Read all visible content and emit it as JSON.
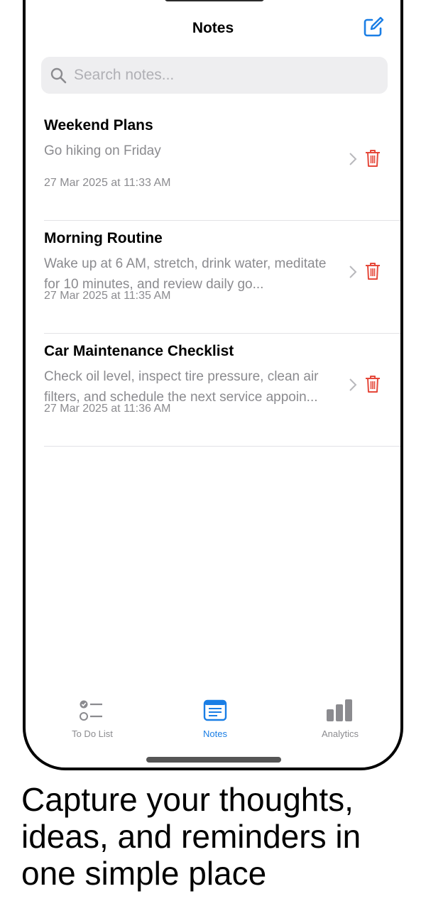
{
  "header": {
    "title": "Notes",
    "compose_icon": "compose-icon"
  },
  "search": {
    "placeholder": "Search notes..."
  },
  "notes": [
    {
      "title": "Weekend Plans",
      "body": "Go hiking on Friday",
      "date": "27 Mar 2025 at 11:33 AM"
    },
    {
      "title": "Morning Routine",
      "body": "Wake up at 6 AM, stretch, drink water, meditate for 10 minutes, and review daily go...",
      "date": "27 Mar 2025 at 11:35 AM"
    },
    {
      "title": "Car Maintenance Checklist",
      "body": "Check oil level, inspect tire pressure, clean air filters, and schedule the next service appoin...",
      "date": "27 Mar 2025 at 11:36 AM"
    }
  ],
  "tabs": [
    {
      "label": "To Do List",
      "icon": "checklist-icon",
      "active": false
    },
    {
      "label": "Notes",
      "icon": "note-icon",
      "active": true
    },
    {
      "label": "Analytics",
      "icon": "bar-chart-icon",
      "active": false
    }
  ],
  "tagline": "Capture your thoughts, ideas, and reminders in one simple place",
  "colors": {
    "accent": "#1a7ee5",
    "delete": "#e5483a",
    "secondary_text": "#8b8b8f"
  }
}
